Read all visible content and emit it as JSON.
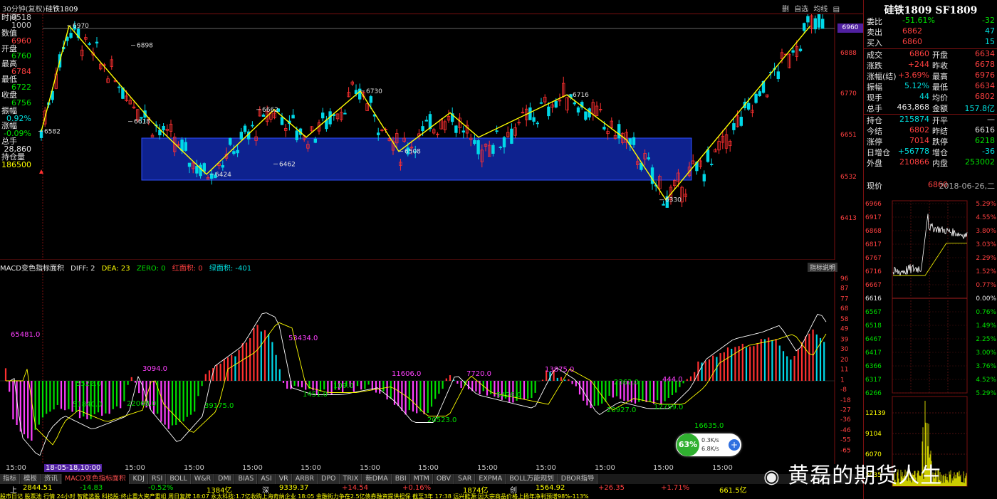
{
  "header": {
    "period": "30分钟(复权)",
    "symbol": "硅铁1809",
    "toolbar": [
      "删",
      "自选",
      "均线",
      "▤"
    ]
  },
  "left_info": [
    {
      "label": "时间",
      "val": "0518"
    },
    {
      "label": "",
      "val": "1000"
    },
    {
      "label": "数值",
      "val": ""
    },
    {
      "label": "",
      "val": "6960",
      "color": "red"
    },
    {
      "label": "开盘",
      "val": ""
    },
    {
      "label": "",
      "val": "6760",
      "color": "grn"
    },
    {
      "label": "最高",
      "val": ""
    },
    {
      "label": "",
      "val": "6784",
      "color": "red"
    },
    {
      "label": "最低",
      "val": ""
    },
    {
      "label": "",
      "val": "6722",
      "color": "grn"
    },
    {
      "label": "收盘",
      "val": ""
    },
    {
      "label": "",
      "val": "6756",
      "color": "grn"
    },
    {
      "label": "振幅",
      "val": ""
    },
    {
      "label": "",
      "val": "0.92%",
      "color": "cyan"
    },
    {
      "label": "涨幅",
      "val": ""
    },
    {
      "label": "",
      "val": "-0.09%",
      "color": "grn"
    },
    {
      "label": "总手",
      "val": ""
    },
    {
      "label": "",
      "val": "28,860",
      "color": "wht"
    },
    {
      "label": "持仓量",
      "val": ""
    },
    {
      "label": "",
      "val": "186500",
      "color": "yel"
    }
  ],
  "price_axis": [
    "7005",
    "6960",
    "6888",
    "6770",
    "6651",
    "6532",
    "6413"
  ],
  "price_badge": "6960",
  "price_marks": [
    {
      "text": "6970"
    },
    {
      "text": "6582"
    },
    {
      "text": "6898"
    },
    {
      "text": "6618"
    },
    {
      "text": "6424"
    },
    {
      "text": "6662"
    },
    {
      "text": "6462"
    },
    {
      "text": "6730"
    },
    {
      "text": "6508"
    },
    {
      "text": "6716"
    },
    {
      "text": "6330"
    }
  ],
  "macd_header": {
    "title": "MACD变色指标面积",
    "diff": "DIFF: 2",
    "dea": "DEA: 23",
    "zero": "ZERO: 0",
    "red": "红面积: 0",
    "green": "绿面积: -401",
    "button": "指标说明"
  },
  "macd_axis": [
    "96",
    "87",
    "77",
    "68",
    "58",
    "49",
    "39",
    "30",
    "20",
    "11",
    "1",
    "-8",
    "-18",
    "-27",
    "-36",
    "-46",
    "-55",
    "-65"
  ],
  "macd_labels": [
    {
      "text": "65481.0",
      "c": "mag"
    },
    {
      "text": "3094.0",
      "c": "mag"
    },
    {
      "text": "53434.0",
      "c": "mag"
    },
    {
      "text": "5522.0",
      "c": "grn"
    },
    {
      "text": "51840.0",
      "c": "grn"
    },
    {
      "text": "22068.0",
      "c": "grn"
    },
    {
      "text": "39175.0",
      "c": "grn"
    },
    {
      "text": "1451.0",
      "c": "grn"
    },
    {
      "text": "109.0",
      "c": "grn"
    },
    {
      "text": "11606.0",
      "c": "mag"
    },
    {
      "text": "7720.0",
      "c": "mag"
    },
    {
      "text": "13875.0",
      "c": "mag"
    },
    {
      "text": "20523.0",
      "c": "grn"
    },
    {
      "text": "5426.0",
      "c": "grn"
    },
    {
      "text": "2362.0",
      "c": "grn"
    },
    {
      "text": "20927.0",
      "c": "grn"
    },
    {
      "text": "12759.0",
      "c": "grn"
    },
    {
      "text": "444.0",
      "c": "mag"
    },
    {
      "text": "16635.0",
      "c": "grn"
    }
  ],
  "time_axis": [
    "15:00",
    "18-05-18,10:00",
    "15:00",
    "15:00",
    "15:00",
    "15:00",
    "15:00",
    "15:00",
    "15:00",
    "15:00",
    "15:00",
    "15:00",
    "15:00"
  ],
  "tabs": [
    "指标",
    "模板",
    "资讯",
    "MACD变色指标面积",
    "KDJ",
    "RSI",
    "BOLL",
    "W&R",
    "DMI",
    "BIAS",
    "ASI",
    "VR",
    "ARBR",
    "DPO",
    "TRIX",
    "新DMA",
    "BBI",
    "MTM",
    "OBV",
    "SAR",
    "EXPMA",
    "BOLL万能规划",
    "DBOR指导"
  ],
  "status": [
    {
      "t": "上",
      "c": "wht"
    },
    {
      "t": "2844.51",
      "c": "yel"
    },
    {
      "t": "-14.83",
      "c": "grn"
    },
    {
      "t": "-0.52%",
      "c": "grn"
    },
    {
      "t": "1384亿",
      "c": "yel"
    },
    {
      "t": "深",
      "c": "wht"
    },
    {
      "t": "9339.37",
      "c": "yel"
    },
    {
      "t": "+14.54",
      "c": "red"
    },
    {
      "t": "+0.16%",
      "c": "red"
    },
    {
      "t": "1874亿",
      "c": "yel"
    },
    {
      "t": "创",
      "c": "wht"
    },
    {
      "t": "1564.92",
      "c": "yel"
    },
    {
      "t": "+26.35",
      "c": "red"
    },
    {
      "t": "+1.71%",
      "c": "red"
    },
    {
      "t": "661.5亿",
      "c": "yel"
    }
  ],
  "ticker": "股市日记  股票池   行情  24小时  智能选股  科技股:终止重大资产重组 周日复牌    18:07 永太科技:1.7亿收购上海奇纳企业    18:05 金融街力争在2.5亿债券融资提供担保  截至3年    17:38 远兴能源:因大宗商品价格上扬年净利预增98%-113%",
  "right": {
    "title": "硅铁1809 SF1809",
    "rows1": [
      {
        "l": "委比",
        "v": "-51.61%",
        "vc": "grn",
        "v2": "-32",
        "v2c": "grn"
      },
      {
        "l": "卖出",
        "v": "6862",
        "vc": "red",
        "v2": "47",
        "v2c": "cyan"
      },
      {
        "l": "买入",
        "v": "6860",
        "vc": "red",
        "v2": "15",
        "v2c": "cyan"
      }
    ],
    "rows2": [
      {
        "l": "成交",
        "v": "6860",
        "vc": "red",
        "l2": "开盘",
        "v2": "6634",
        "v2c": "red"
      },
      {
        "l": "涨跌",
        "v": "+244",
        "vc": "red",
        "l2": "昨收",
        "v2": "6678",
        "v2c": "red"
      },
      {
        "l": "涨幅(结)",
        "v": "+3.69%",
        "vc": "red",
        "l2": "最高",
        "v2": "6976",
        "v2c": "red"
      },
      {
        "l": "振幅",
        "v": "5.12%",
        "vc": "cyan",
        "l2": "最低",
        "v2": "6634",
        "v2c": "red"
      },
      {
        "l": "现手",
        "v": "44",
        "vc": "cyan",
        "l2": "均价",
        "v2": "6802",
        "v2c": "red"
      },
      {
        "l": "总手",
        "v": "463,868",
        "vc": "wht",
        "l2": "金额",
        "v2": "157.8亿",
        "v2c": "cyan"
      }
    ],
    "rows3": [
      {
        "l": "持仓",
        "v": "215874",
        "vc": "cyan",
        "l2": "开平",
        "v2": "—",
        "v2c": "wht"
      },
      {
        "l": "今结",
        "v": "6802",
        "vc": "red",
        "l2": "昨结",
        "v2": "6616",
        "v2c": "wht"
      },
      {
        "l": "涨停",
        "v": "7014",
        "vc": "red",
        "l2": "跌停",
        "v2": "6218",
        "v2c": "grn"
      },
      {
        "l": "日增仓",
        "v": "+56778",
        "vc": "cyan",
        "l2": "增仓",
        "v2": "-36",
        "v2c": "cyan"
      },
      {
        "l": "外盘",
        "v": "210866",
        "vc": "red",
        "l2": "内盘",
        "v2": "253002",
        "v2c": "grn"
      }
    ],
    "now_label": "现价",
    "now_val": "6860",
    "date": "2018-06-26,二",
    "intraday_left": [
      "6966",
      "6917",
      "6868",
      "6817",
      "6767",
      "6716",
      "6667",
      "6616",
      "6567",
      "6518",
      "6467",
      "6417",
      "6366",
      "6317",
      "6266"
    ],
    "intraday_right": [
      "5.29%",
      "4.55%",
      "3.80%",
      "3.03%",
      "2.29%",
      "1.52%",
      "0.77%",
      "0.00%",
      "0.76%",
      "1.49%",
      "2.25%",
      "3.00%",
      "3.76%",
      "4.52%",
      "5.29%"
    ],
    "vol_left": [
      "12139",
      "9104",
      "6070",
      "3035"
    ]
  },
  "widget": {
    "pct": "63%",
    "up": "0.3K/s",
    "down": "6.8K/s"
  },
  "watermark": "黄磊的期货人生"
}
